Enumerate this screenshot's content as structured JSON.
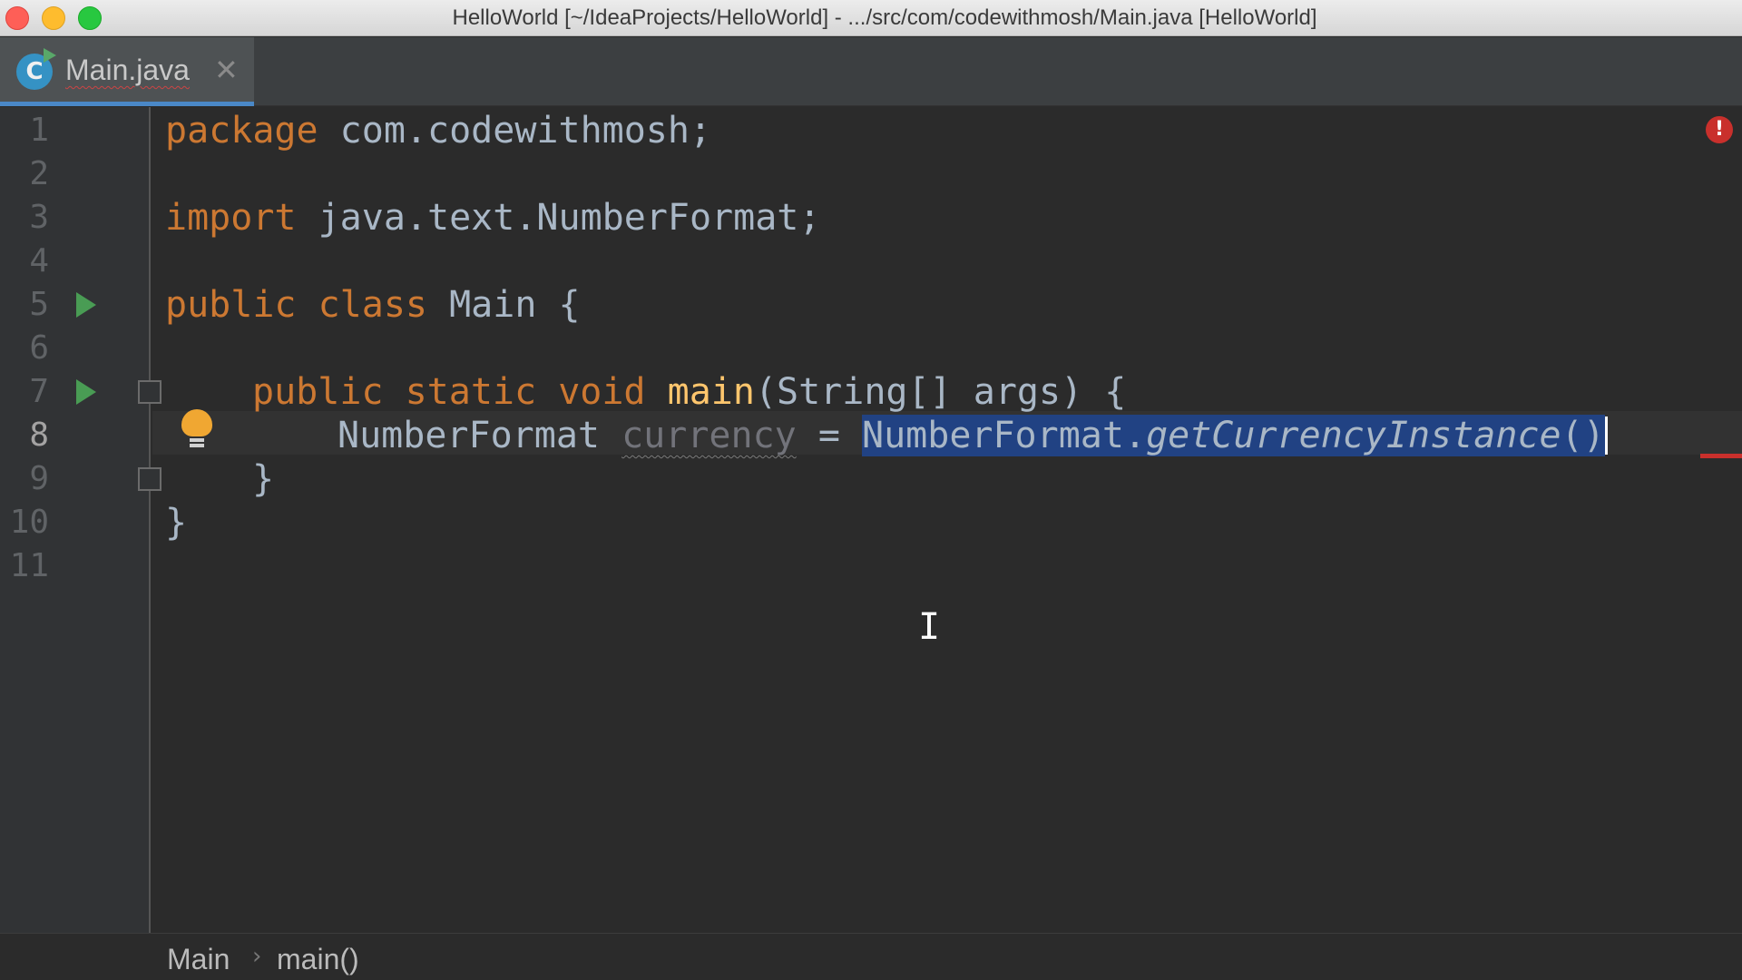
{
  "window": {
    "title": "HelloWorld [~/IdeaProjects/HelloWorld] - .../src/com/codewithmosh/Main.java [HelloWorld]"
  },
  "tabs": [
    {
      "label": "Main.java",
      "icon": "java-class-icon",
      "close_glyph": "✕"
    }
  ],
  "editor": {
    "line_numbers": [
      "1",
      "2",
      "3",
      "4",
      "5",
      "6",
      "7",
      "8",
      "9",
      "10",
      "11"
    ],
    "code": {
      "l1_kw": "package",
      "l1_rest": " com.codewithmosh;",
      "l3_kw": "import",
      "l3_rest": " java.text.NumberFormat;",
      "l5_kw1": "public",
      "l5_kw2": "class",
      "l5_rest": " Main {",
      "l7_kw1": "public",
      "l7_kw2": "static",
      "l7_kw3": "void",
      "l7_fn": "main",
      "l7_rest": "(String[] args) {",
      "l8_type": "NumberFormat ",
      "l8_var": "currency",
      "l8_eq": " = ",
      "l8_sel_a": "NumberFormat.",
      "l8_sel_b": "getCurrencyInstance",
      "l8_sel_c": "()",
      "l9": "}",
      "l10": "}"
    },
    "error_indicator": "!"
  },
  "breadcrumb": {
    "items": [
      "Main",
      "main()"
    ],
    "separator": "›"
  }
}
